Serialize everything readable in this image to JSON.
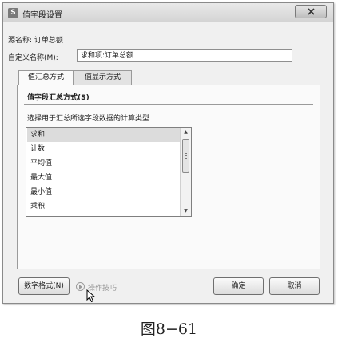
{
  "window": {
    "title": "值字段设置",
    "app_icon_letter": "S"
  },
  "source_name": {
    "label": "源名称:",
    "value": "订单总额"
  },
  "custom_name": {
    "label": "自定义名称(M):",
    "value": "求和项:订单总额"
  },
  "tabs": [
    {
      "label": "值汇总方式",
      "active": true
    },
    {
      "label": "值显示方式",
      "active": false
    }
  ],
  "summarize": {
    "section_title": "值字段汇总方式(S)",
    "instruction": "选择用于汇总所选字段数据的计算类型",
    "items": [
      "求和",
      "计数",
      "平均值",
      "最大值",
      "最小值",
      "乘积"
    ],
    "selected_index": 0
  },
  "footer": {
    "number_format_label": "数字格式(N)",
    "tips_label": "操作技巧",
    "ok_label": "确定",
    "cancel_label": "取消"
  },
  "caption": "图8−61"
}
